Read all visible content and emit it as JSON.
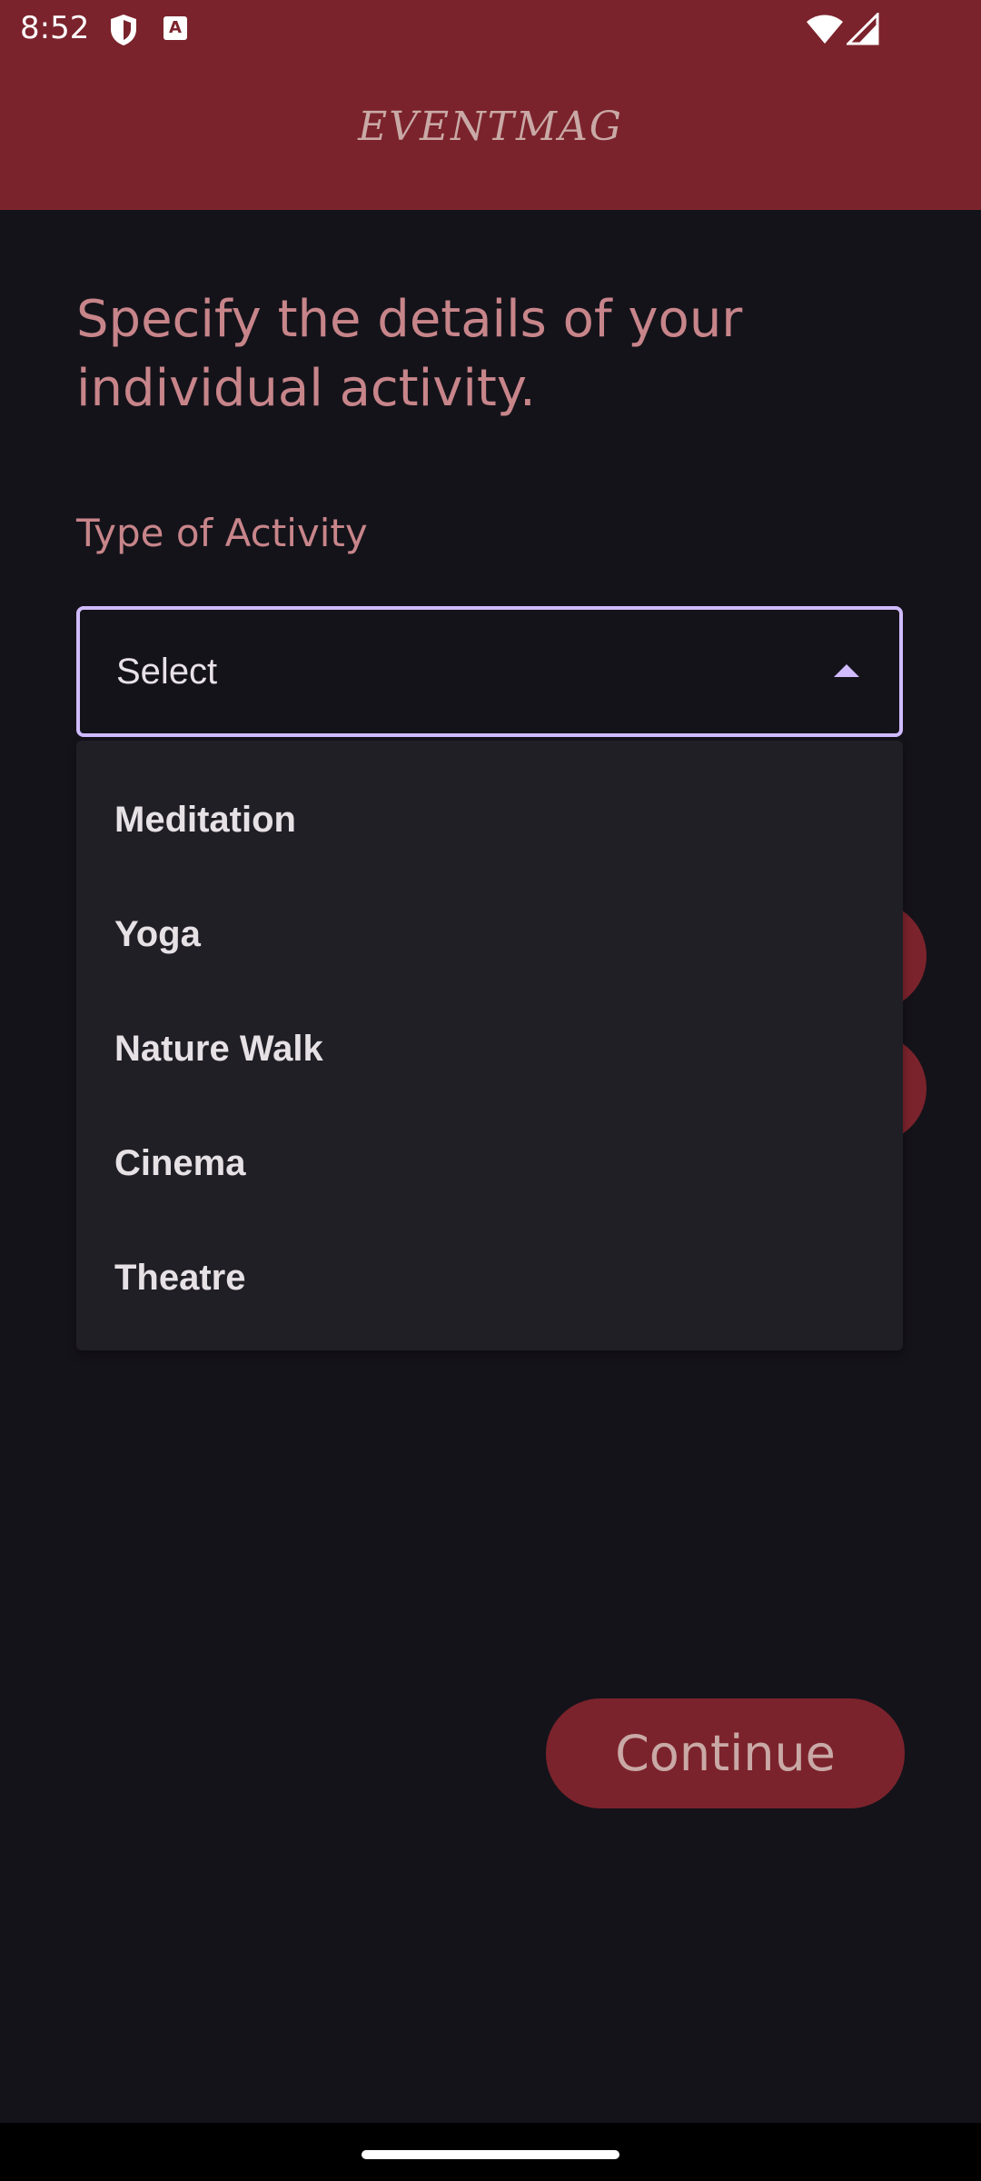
{
  "status_bar": {
    "time": "8:52",
    "icons": [
      "shield-icon",
      "a-notification-icon",
      "wifi-icon",
      "signal-icon"
    ],
    "a_icon_text": "A"
  },
  "app_bar": {
    "title": "EVENTMAG",
    "color": "#7b232c"
  },
  "form": {
    "heading": "Specify the details of your individual activity.",
    "activity_label": "Type of Activity",
    "select": {
      "value": "Select",
      "expanded": true,
      "accent": "#d0bcff"
    },
    "options": [
      "Meditation",
      "Yoga",
      "Nature Walk",
      "Cinema",
      "Theatre"
    ]
  },
  "actions": {
    "continue_label": "Continue"
  }
}
